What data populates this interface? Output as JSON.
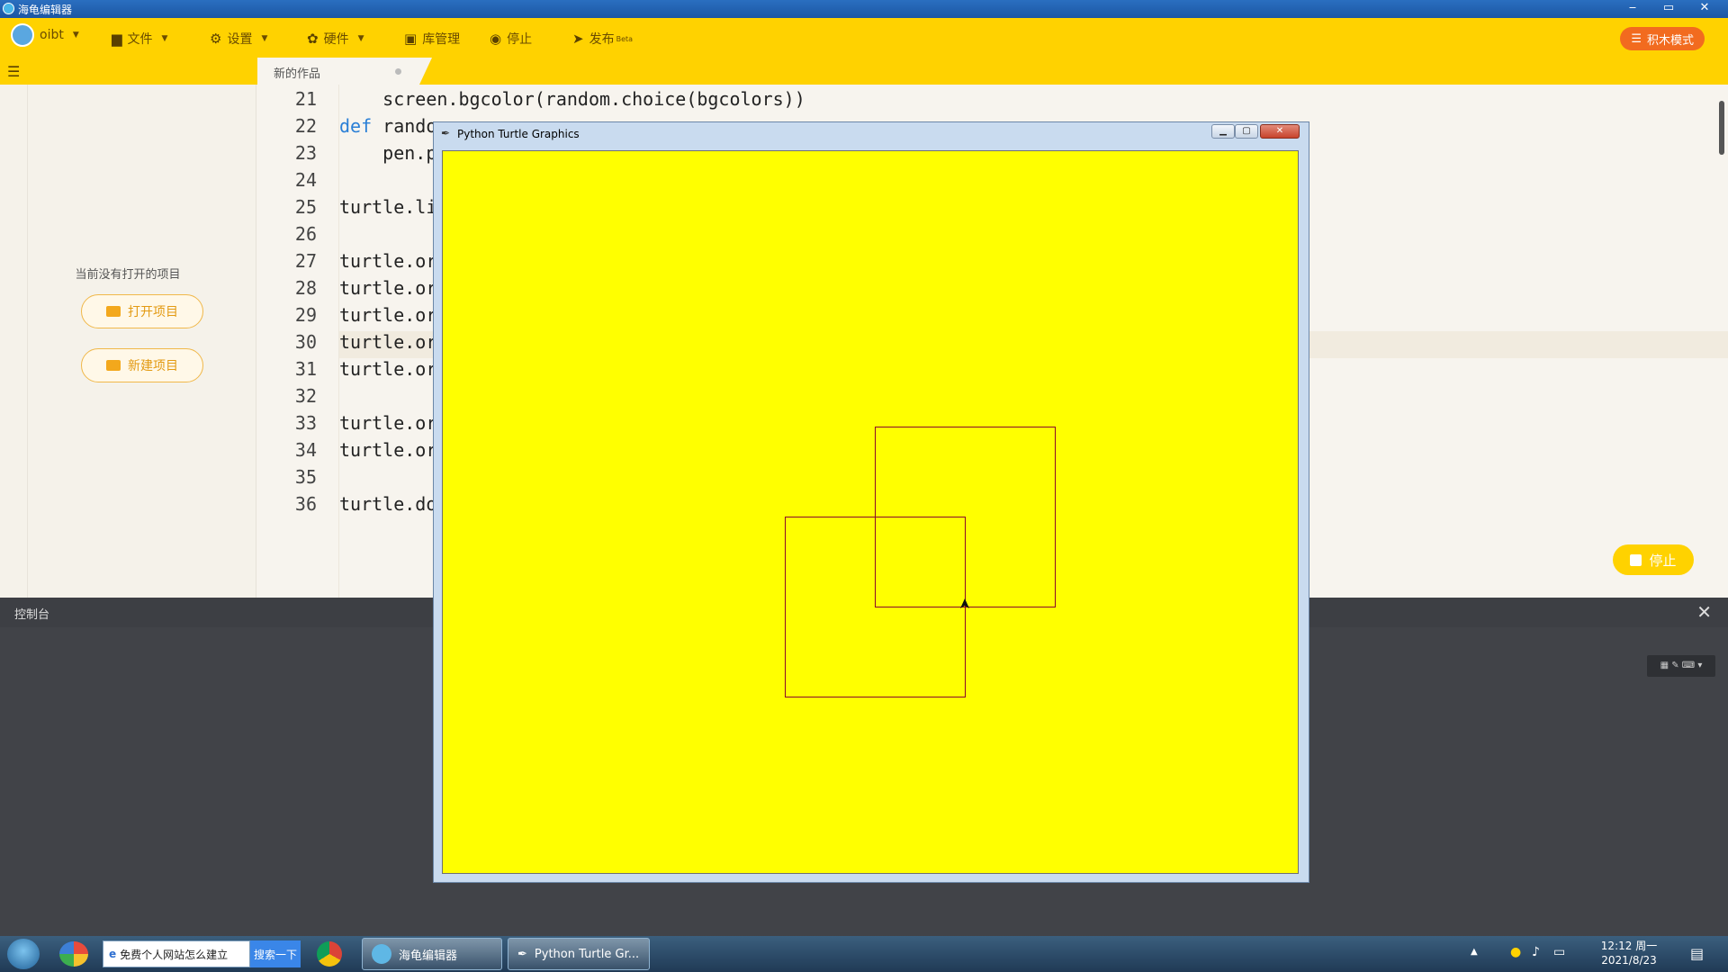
{
  "titlebar": {
    "title": "海龟编辑器",
    "minimize": "‒",
    "maximize": "▭",
    "close": "✕"
  },
  "toolbar": {
    "user": "oibt",
    "file": "文件",
    "settings": "设置",
    "hardware": "硬件",
    "library": "库管理",
    "stop": "停止",
    "publish": "发布",
    "publish_badge": "Beta",
    "mode_button": "积木模式"
  },
  "tab": {
    "label": "新的作品"
  },
  "sidebar": {
    "no_project_text": "当前没有打开的项目",
    "open_project": "打开项目",
    "new_project": "新建项目"
  },
  "editor": {
    "lines": [
      {
        "num": "21",
        "text": "    screen.bgcolor(random.choice(bgcolors))"
      },
      {
        "num": "22",
        "kw": "def",
        "text": " rando"
      },
      {
        "num": "23",
        "text": "    pen.p"
      },
      {
        "num": "24",
        "text": ""
      },
      {
        "num": "25",
        "text": "turtle.li"
      },
      {
        "num": "26",
        "text": ""
      },
      {
        "num": "27",
        "text": "turtle.or"
      },
      {
        "num": "28",
        "text": "turtle.or"
      },
      {
        "num": "29",
        "text": "turtle.or"
      },
      {
        "num": "30",
        "text": "turtle.or"
      },
      {
        "num": "31",
        "text": "turtle.or"
      },
      {
        "num": "32",
        "text": ""
      },
      {
        "num": "33",
        "text": "turtle.or"
      },
      {
        "num": "34",
        "text": "turtle.or"
      },
      {
        "num": "35",
        "text": ""
      },
      {
        "num": "36",
        "text": "turtle.do"
      }
    ],
    "stop_button": "停止"
  },
  "console": {
    "title": "控制台",
    "close": "✕"
  },
  "turtle_window": {
    "title": "Python Turtle Graphics",
    "canvas_color": "#ffff00",
    "stroke_color": "#8b0a2a"
  },
  "taskbar": {
    "search_text": "免费个人网站怎么建立",
    "search_button": "搜索一下",
    "app1": "海龟编辑器",
    "app2": "Python Turtle Gr...",
    "time": "12:12 周一",
    "date": "2021/8/23"
  },
  "colors": {
    "toolbar": "#ffd200",
    "accent_orange": "#f26b1f",
    "console_bg": "#414348"
  }
}
